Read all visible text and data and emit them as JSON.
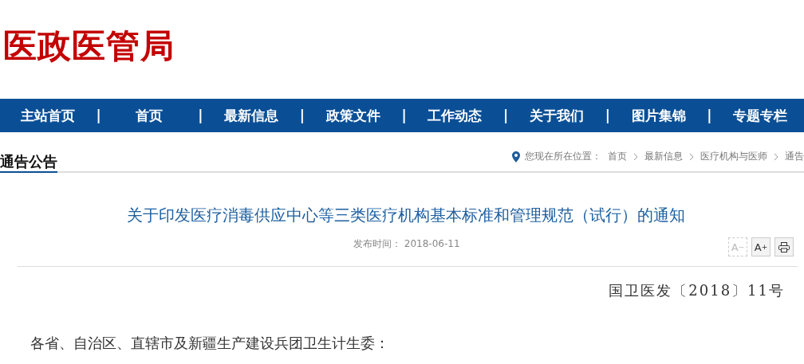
{
  "site_title": "医政医管局",
  "nav": {
    "separator": "|",
    "items": [
      "主站首页",
      "首页",
      "最新信息",
      "政策文件",
      "工作动态",
      "关于我们",
      "图片集锦",
      "专题专栏"
    ]
  },
  "section_title": "通告公告",
  "breadcrumb": {
    "label": "您现在所在位置：",
    "items": [
      "首页",
      "最新信息",
      "医疗机构与医师",
      "通告"
    ]
  },
  "article": {
    "title": "关于印发医疗消毒供应中心等三类医疗机构基本标准和管理规范（试行）的通知",
    "published": "发布时间： 2018-06-11",
    "tools": [
      {
        "kind": "font-smaller",
        "label": "A",
        "sup": "−",
        "disabled": true
      },
      {
        "kind": "font-larger",
        "label": "A",
        "sup": "+",
        "disabled": false
      },
      {
        "kind": "print",
        "disabled": false
      }
    ],
    "doc_number": "国卫医发〔2018〕11号",
    "salutation": "各省、自治区、直辖市及新疆生产建设兵团卫生计生委："
  }
}
